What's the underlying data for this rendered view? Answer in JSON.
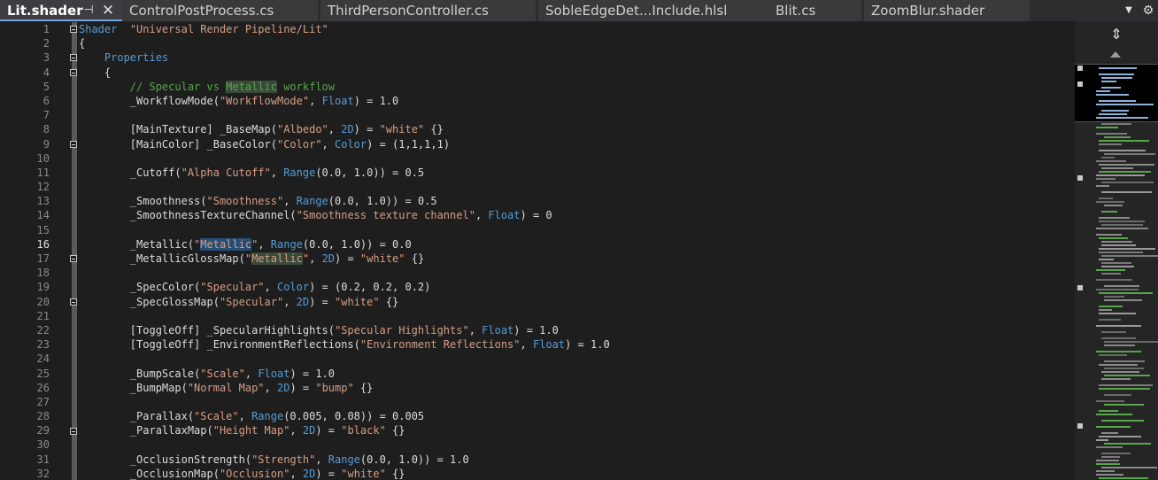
{
  "tabs": [
    {
      "label": "Lit.shader",
      "active": true
    },
    {
      "label": "ControlPostProcess.cs",
      "active": false
    },
    {
      "label": "ThirdPersonController.cs",
      "active": false
    },
    {
      "label": "SobleEdgeDet...Include.hlsl",
      "active": false
    },
    {
      "label": "Blit.cs",
      "active": false
    },
    {
      "label": "ZoomBlur.shader",
      "active": false
    }
  ],
  "toolbar": {
    "pin_glyph": "⊣",
    "close_glyph": "✕",
    "dropdown_glyph": "▼",
    "settings_glyph": "⚙"
  },
  "editor": {
    "current_line": 16,
    "lines": [
      "1",
      "2",
      "3",
      "4",
      "5",
      "6",
      "7",
      "8",
      "9",
      "10",
      "11",
      "12",
      "13",
      "14",
      "15",
      "16",
      "17",
      "18",
      "19",
      "20",
      "21",
      "22",
      "23",
      "24",
      "25",
      "26",
      "27",
      "28",
      "29",
      "30",
      "31",
      "32"
    ],
    "code": [
      [
        [
          "kw",
          "Shader"
        ],
        [
          "",
          "  "
        ],
        [
          "str",
          "\"Universal Render Pipeline/Lit\""
        ]
      ],
      [
        [
          "",
          "{"
        ]
      ],
      [
        [
          "",
          "    "
        ],
        [
          "kw",
          "Properties"
        ]
      ],
      [
        [
          "",
          "    {"
        ]
      ],
      [
        [
          "",
          "        "
        ],
        [
          "cm",
          "// Specular vs "
        ],
        [
          "cmh",
          "Metallic"
        ],
        [
          "cm",
          " workflow"
        ]
      ],
      [
        [
          "",
          "        _WorkflowMode("
        ],
        [
          "str",
          "\"WorkflowMode\""
        ],
        [
          "",
          ", "
        ],
        [
          "kw",
          "Float"
        ],
        [
          "",
          ") = 1.0"
        ]
      ],
      [
        [
          "",
          ""
        ]
      ],
      [
        [
          "",
          "        [MainTexture] _BaseMap("
        ],
        [
          "str",
          "\"Albedo\""
        ],
        [
          "",
          ", "
        ],
        [
          "kw",
          "2D"
        ],
        [
          "",
          ") = "
        ],
        [
          "str",
          "\"white\""
        ],
        [
          "",
          " {}"
        ]
      ],
      [
        [
          "",
          "        [MainColor] _BaseColor("
        ],
        [
          "str",
          "\"Color\""
        ],
        [
          "",
          ", "
        ],
        [
          "kw",
          "Color"
        ],
        [
          "",
          ") = (1,1,1,1)"
        ]
      ],
      [
        [
          "",
          ""
        ]
      ],
      [
        [
          "",
          "        _Cutoff("
        ],
        [
          "str",
          "\"Alpha Cutoff\""
        ],
        [
          "",
          ", "
        ],
        [
          "kw",
          "Range"
        ],
        [
          "",
          "(0.0, 1.0)) = 0.5"
        ]
      ],
      [
        [
          "",
          ""
        ]
      ],
      [
        [
          "",
          "        _Smoothness("
        ],
        [
          "str",
          "\"Smoothness\""
        ],
        [
          "",
          ", "
        ],
        [
          "kw",
          "Range"
        ],
        [
          "",
          "(0.0, 1.0)) = 0.5"
        ]
      ],
      [
        [
          "",
          "        _SmoothnessTextureChannel("
        ],
        [
          "str",
          "\"Smoothness texture channel\""
        ],
        [
          "",
          ", "
        ],
        [
          "kw",
          "Float"
        ],
        [
          "",
          ") = 0"
        ]
      ],
      [
        [
          "",
          ""
        ]
      ],
      [
        [
          "",
          "        _Metallic("
        ],
        [
          "str",
          "\""
        ],
        [
          "hl",
          "Metallic"
        ],
        [
          "str",
          "\""
        ],
        [
          "",
          ", "
        ],
        [
          "kw",
          "Range"
        ],
        [
          "",
          "(0.0, 1.0)) = 0.0"
        ]
      ],
      [
        [
          "",
          "        _MetallicGlossMap("
        ],
        [
          "str",
          "\""
        ],
        [
          "strh",
          "Metallic"
        ],
        [
          "str",
          "\""
        ],
        [
          "",
          ", "
        ],
        [
          "kw",
          "2D"
        ],
        [
          "",
          ") = "
        ],
        [
          "str",
          "\"white\""
        ],
        [
          "",
          " {}"
        ]
      ],
      [
        [
          "",
          ""
        ]
      ],
      [
        [
          "",
          "        _SpecColor("
        ],
        [
          "str",
          "\"Specular\""
        ],
        [
          "",
          ", "
        ],
        [
          "kw",
          "Color"
        ],
        [
          "",
          ") = (0.2, 0.2, 0.2)"
        ]
      ],
      [
        [
          "",
          "        _SpecGlossMap("
        ],
        [
          "str",
          "\"Specular\""
        ],
        [
          "",
          ", "
        ],
        [
          "kw",
          "2D"
        ],
        [
          "",
          ") = "
        ],
        [
          "str",
          "\"white\""
        ],
        [
          "",
          " {}"
        ]
      ],
      [
        [
          "",
          ""
        ]
      ],
      [
        [
          "",
          "        [ToggleOff] _SpecularHighlights("
        ],
        [
          "str",
          "\"Specular Highlights\""
        ],
        [
          "",
          ", "
        ],
        [
          "kw",
          "Float"
        ],
        [
          "",
          ") = 1.0"
        ]
      ],
      [
        [
          "",
          "        [ToggleOff] _EnvironmentReflections("
        ],
        [
          "str",
          "\"Environment Reflections\""
        ],
        [
          "",
          ", "
        ],
        [
          "kw",
          "Float"
        ],
        [
          "",
          ") = 1.0"
        ]
      ],
      [
        [
          "",
          ""
        ]
      ],
      [
        [
          "",
          "        _BumpScale("
        ],
        [
          "str",
          "\"Scale\""
        ],
        [
          "",
          ", "
        ],
        [
          "kw",
          "Float"
        ],
        [
          "",
          ") = 1.0"
        ]
      ],
      [
        [
          "",
          "        _BumpMap("
        ],
        [
          "str",
          "\"Normal Map\""
        ],
        [
          "",
          ", "
        ],
        [
          "kw",
          "2D"
        ],
        [
          "",
          ") = "
        ],
        [
          "str",
          "\"bump\""
        ],
        [
          "",
          " {}"
        ]
      ],
      [
        [
          "",
          ""
        ]
      ],
      [
        [
          "",
          "        _Parallax("
        ],
        [
          "str",
          "\"Scale\""
        ],
        [
          "",
          ", "
        ],
        [
          "kw",
          "Range"
        ],
        [
          "",
          "(0.005, 0.08)) = 0.005"
        ]
      ],
      [
        [
          "",
          "        _ParallaxMap("
        ],
        [
          "str",
          "\"Height Map\""
        ],
        [
          "",
          ", "
        ],
        [
          "kw",
          "2D"
        ],
        [
          "",
          ") = "
        ],
        [
          "str",
          "\"black\""
        ],
        [
          "",
          " {}"
        ]
      ],
      [
        [
          "",
          ""
        ]
      ],
      [
        [
          "",
          "        _OcclusionStrength("
        ],
        [
          "str",
          "\"Strength\""
        ],
        [
          "",
          ", "
        ],
        [
          "kw",
          "Range"
        ],
        [
          "",
          "(0.0, 1.0)) = 1.0"
        ]
      ],
      [
        [
          "",
          "        _OcclusionMap("
        ],
        [
          "str",
          "\"Occlusion\""
        ],
        [
          "",
          ", "
        ],
        [
          "kw",
          "2D"
        ],
        [
          "",
          ") = "
        ],
        [
          "str",
          "\"white\""
        ],
        [
          "",
          " {}"
        ]
      ]
    ]
  },
  "colors": {
    "keyword": "#569cd6",
    "string": "#d69d85",
    "comment": "#57a64a",
    "text": "#dcdcdc",
    "selection": "#264f78",
    "accent": "#6ea4de"
  },
  "minimap": {
    "split_glyph": "⇕"
  }
}
